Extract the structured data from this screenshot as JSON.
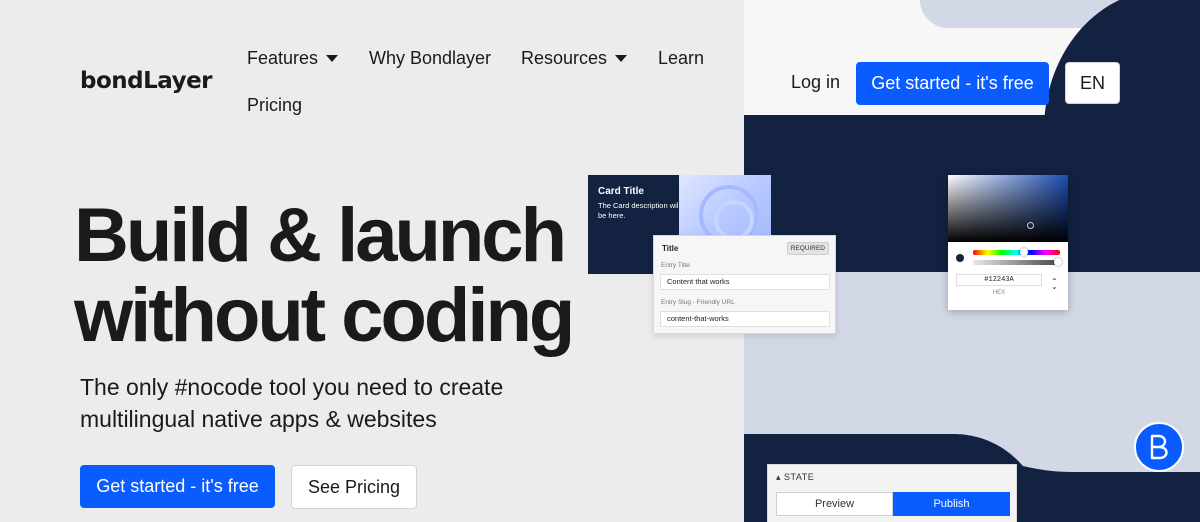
{
  "brand": {
    "logo_text": "bondLayer",
    "primary_color": "#0b5cff",
    "dark_color": "#122240"
  },
  "nav": {
    "items": [
      {
        "label": "Features",
        "has_dropdown": true
      },
      {
        "label": "Why Bondlayer",
        "has_dropdown": false
      },
      {
        "label": "Resources",
        "has_dropdown": true
      },
      {
        "label": "Learn",
        "has_dropdown": false
      },
      {
        "label": "Pricing",
        "has_dropdown": false
      }
    ],
    "login_label": "Log in",
    "cta_label": "Get started - it's free",
    "lang_label": "EN"
  },
  "hero": {
    "title_line1": "Build & launch",
    "title_line2": "without coding",
    "subtitle": "The only #nocode tool you need to create multilingual native apps & websites",
    "cta_primary": "Get started - it's free",
    "cta_secondary": "See Pricing"
  },
  "card_mock": {
    "title": "Card Title",
    "description": "The Card description will be here."
  },
  "form_mock": {
    "title": "Title",
    "required_badge": "REQUIRED",
    "entry_title_label": "Entry Title",
    "entry_title_value": "Content that works",
    "slug_label": "Entry Slug - Friendly URL",
    "slug_value": "content-that-works"
  },
  "color_picker": {
    "hex_value": "#12243A",
    "hex_label": "HEX"
  },
  "state_panel": {
    "label": "STATE",
    "preview_label": "Preview",
    "publish_label": "Publish"
  },
  "chat": {
    "icon": "bondlayer-b-icon"
  }
}
